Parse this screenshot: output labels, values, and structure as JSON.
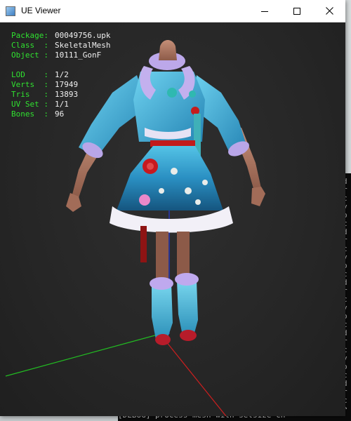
{
  "window": {
    "title": "UE Viewer",
    "controls": {
      "minimize": "minimize",
      "maximize": "maximize",
      "close": "close"
    }
  },
  "info": {
    "package": {
      "label": "Package:",
      "value": "00049756.upk"
    },
    "class": {
      "label": "Class  :",
      "value": "SkeletalMesh"
    },
    "object": {
      "label": "Object :",
      "value": "10111_GonF"
    },
    "lod": {
      "label": "LOD    :",
      "value": "1/2"
    },
    "verts": {
      "label": "Verts  :",
      "value": "17949"
    },
    "tris": {
      "label": "Tris   :",
      "value": "13893"
    },
    "uvset": {
      "label": "UV Set :",
      "value": "1/1"
    },
    "bones": {
      "label": "Bones  :",
      "value": "96"
    }
  },
  "background_console": {
    "bottom_line": "[DEBUG] process  mesh with setsize  ch",
    "side_chars": [
      "d",
      "r",
      "c",
      "y",
      "o",
      "c",
      "d",
      "r",
      "c",
      "y",
      "o",
      "c",
      "d",
      "r",
      "c",
      "y",
      "o",
      "c",
      "d",
      "r",
      "c",
      "y",
      "o",
      "c",
      "d",
      "r",
      "c",
      "e",
      "o"
    ]
  },
  "colors": {
    "info_label": "#30e030",
    "info_value": "#f0f0f0",
    "axis_x": "#cc1f1f",
    "axis_y": "#22bb22",
    "axis_z": "#2a3ad6",
    "viewport_bg": "#282828"
  }
}
